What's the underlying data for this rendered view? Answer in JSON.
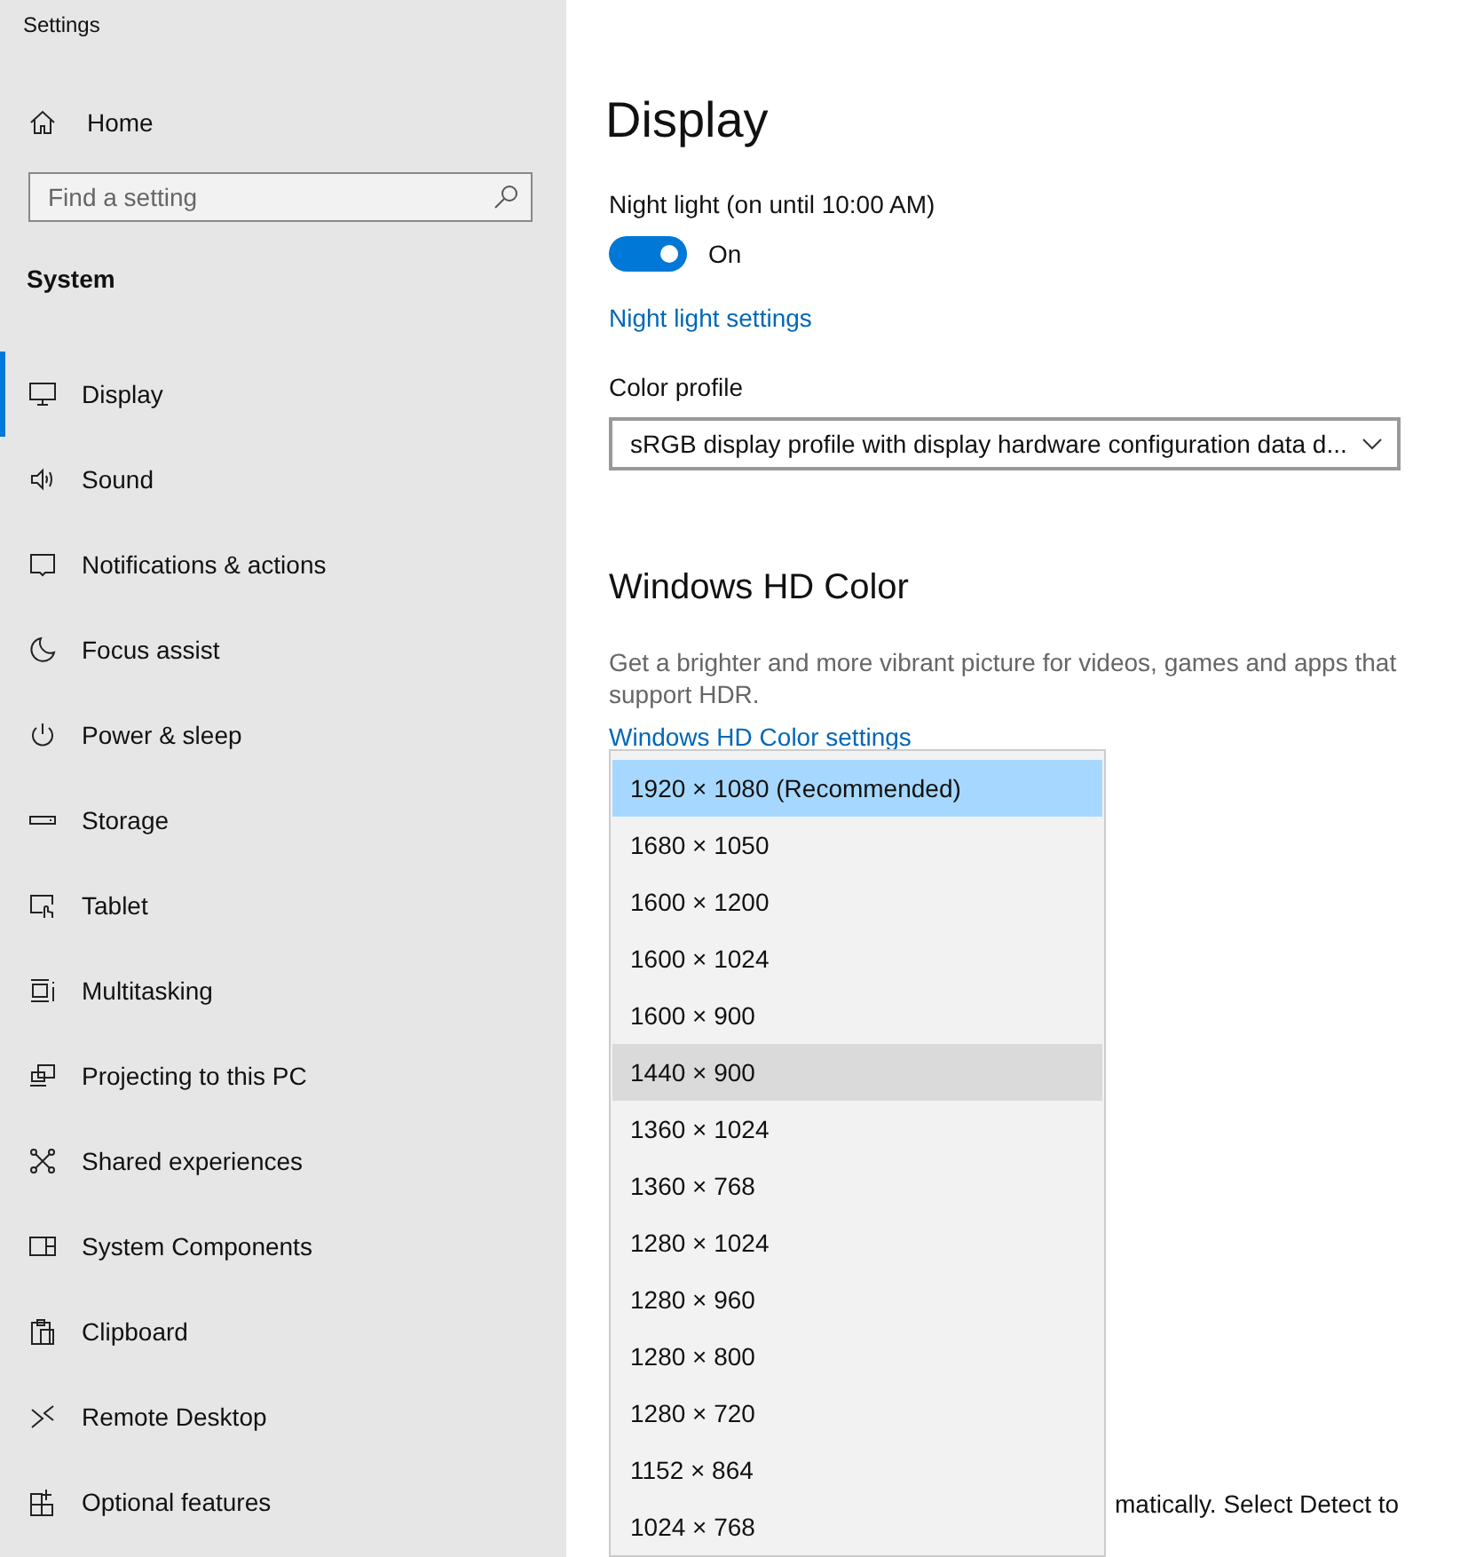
{
  "window": {
    "title": "Settings"
  },
  "sidebar": {
    "home": "Home",
    "search": {
      "placeholder": "Find a setting"
    },
    "section": "System",
    "items": [
      {
        "label": "Display",
        "selected": true
      },
      {
        "label": "Sound",
        "selected": false
      },
      {
        "label": "Notifications & actions",
        "selected": false
      },
      {
        "label": "Focus assist",
        "selected": false
      },
      {
        "label": "Power & sleep",
        "selected": false
      },
      {
        "label": "Storage",
        "selected": false
      },
      {
        "label": "Tablet",
        "selected": false
      },
      {
        "label": "Multitasking",
        "selected": false
      },
      {
        "label": "Projecting to this PC",
        "selected": false
      },
      {
        "label": "Shared experiences",
        "selected": false
      },
      {
        "label": "System Components",
        "selected": false
      },
      {
        "label": "Clipboard",
        "selected": false
      },
      {
        "label": "Remote Desktop",
        "selected": false
      },
      {
        "label": "Optional features",
        "selected": false
      }
    ]
  },
  "main": {
    "title": "Display",
    "night_light": {
      "label": "Night light (on until 10:00 AM)",
      "on": true,
      "state_text": "On",
      "link": "Night light settings"
    },
    "color_profile": {
      "label": "Color profile",
      "value": "sRGB display profile with display hardware configuration data d..."
    },
    "hd_color": {
      "heading": "Windows HD Color",
      "description": "Get a brighter and more vibrant picture for videos, games and apps that support HDR.",
      "link": "Windows HD Color settings"
    },
    "partial_text": "matically. Select Detect to"
  },
  "resolution_list": [
    {
      "label": "1920 × 1080 (Recommended)",
      "selected": true,
      "hovered": false
    },
    {
      "label": "1680 × 1050",
      "selected": false,
      "hovered": false
    },
    {
      "label": "1600 × 1200",
      "selected": false,
      "hovered": false
    },
    {
      "label": "1600 × 1024",
      "selected": false,
      "hovered": false
    },
    {
      "label": "1600 × 900",
      "selected": false,
      "hovered": false
    },
    {
      "label": "1440 × 900",
      "selected": false,
      "hovered": true
    },
    {
      "label": "1360 × 1024",
      "selected": false,
      "hovered": false
    },
    {
      "label": "1360 × 768",
      "selected": false,
      "hovered": false
    },
    {
      "label": "1280 × 1024",
      "selected": false,
      "hovered": false
    },
    {
      "label": "1280 × 960",
      "selected": false,
      "hovered": false
    },
    {
      "label": "1280 × 800",
      "selected": false,
      "hovered": false
    },
    {
      "label": "1280 × 720",
      "selected": false,
      "hovered": false
    },
    {
      "label": "1152 × 864",
      "selected": false,
      "hovered": false
    },
    {
      "label": "1024 × 768",
      "selected": false,
      "hovered": false
    }
  ]
}
